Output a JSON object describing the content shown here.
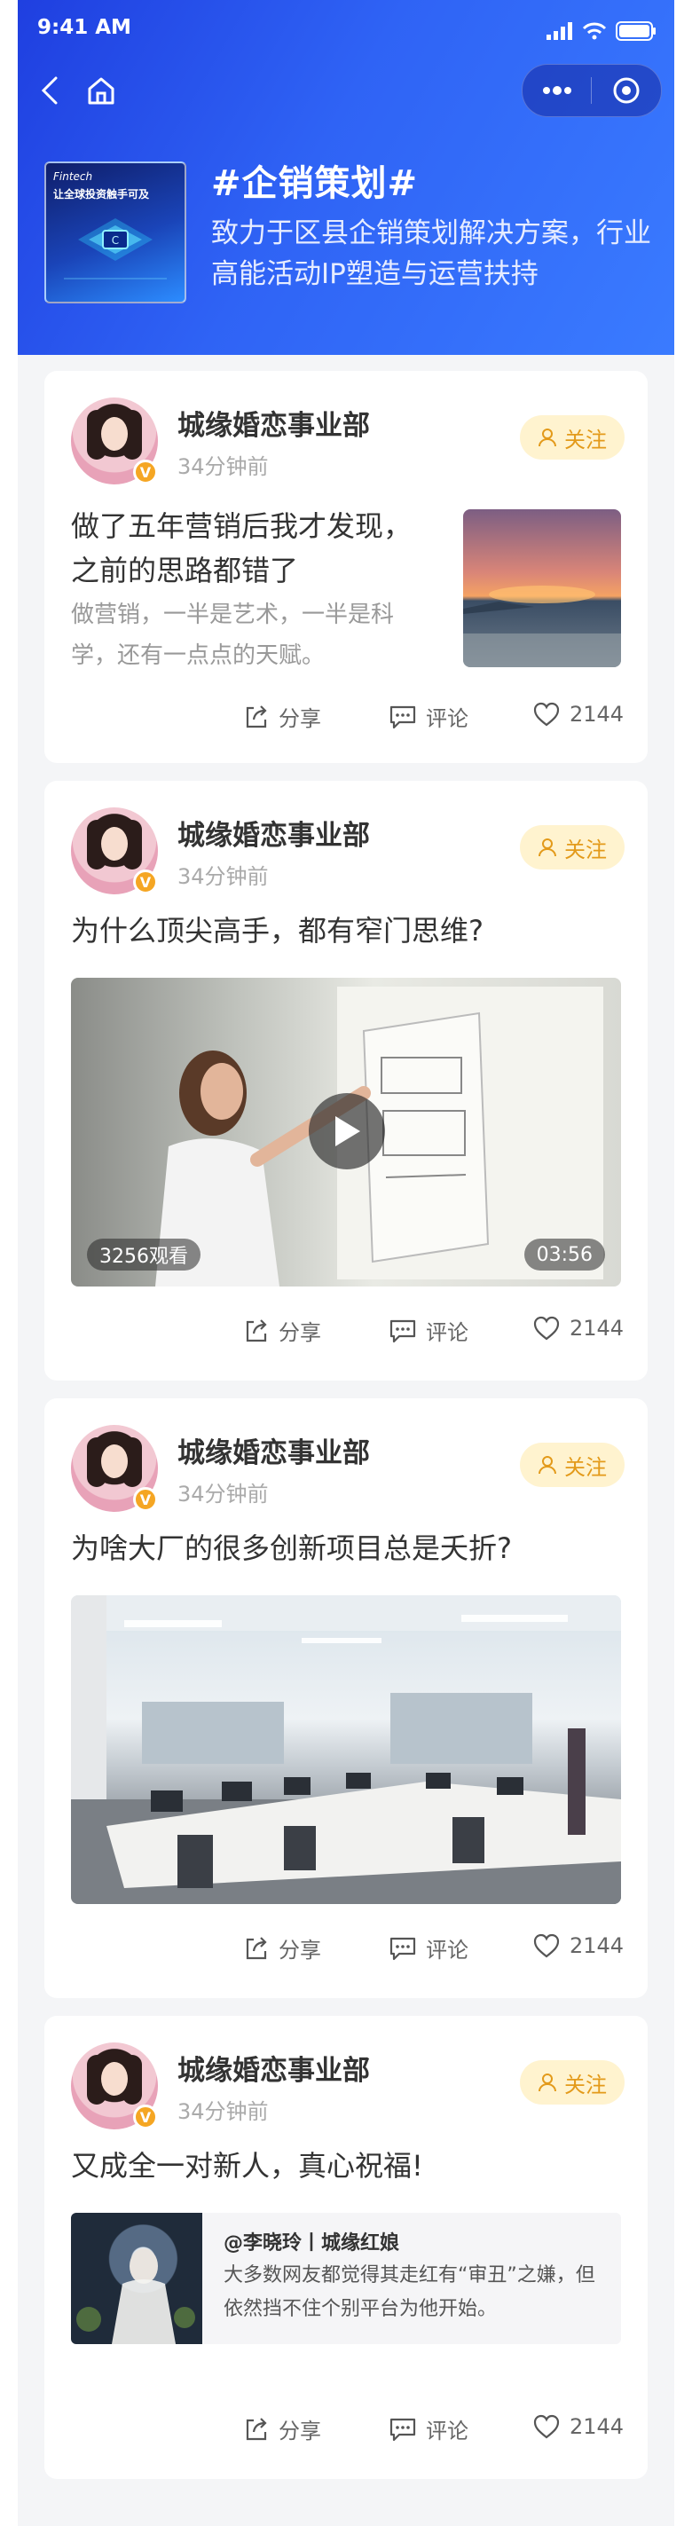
{
  "status_bar": {
    "time": "9:41 AM"
  },
  "header": {
    "title": "#企销策划#",
    "description": "致力于区县企销策划解决方案，行业高能活动IP塑造与运营扶持",
    "cover_line1": "Fintech",
    "cover_line2": "让全球投资触手可及"
  },
  "follow_label": "关注",
  "actions": {
    "share": "分享",
    "comment": "评论",
    "like_count": "2144"
  },
  "posts": [
    {
      "author": "城缘婚恋事业部",
      "time": "34分钟前",
      "title": "做了五年营销后我才发现，之前的思路都错了",
      "summary": "做营销，一半是艺术，一半是科学，还有一点点的天赋。"
    },
    {
      "author": "城缘婚恋事业部",
      "time": "34分钟前",
      "title": "为什么顶尖高手，都有窄门思维?",
      "views": "3256观看",
      "duration": "03:56"
    },
    {
      "author": "城缘婚恋事业部",
      "time": "34分钟前",
      "title": "为啥大厂的很多创新项目总是夭折?"
    },
    {
      "author": "城缘婚恋事业部",
      "time": "34分钟前",
      "title": "又成全一对新人，真心祝福!",
      "quote_title": "@李晓玲丨城缘红娘",
      "quote_text": "大多数网友都觉得其走红有“审丑”之嫌，但依然挡不住个别平台为他开始。"
    }
  ]
}
